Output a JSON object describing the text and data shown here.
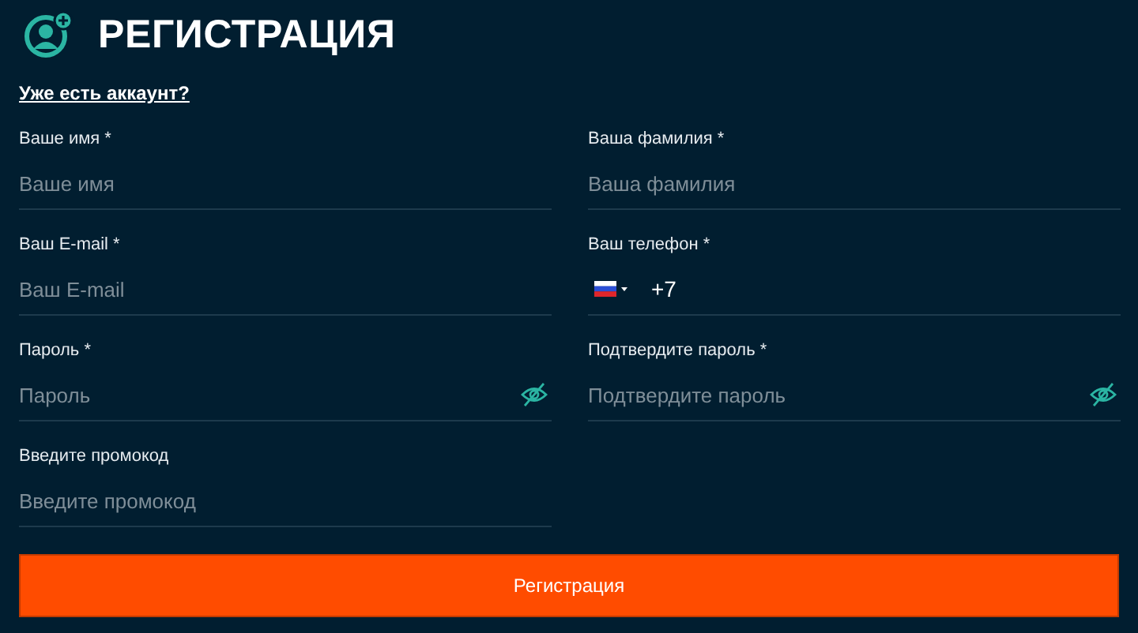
{
  "title": "РЕГИСТРАЦИЯ",
  "login_link": "Уже есть аккаунт?",
  "fields": [
    {
      "kind": "text",
      "label": "Ваше имя *",
      "placeholder": "Ваше имя"
    },
    {
      "kind": "text",
      "label": "Ваша фамилия *",
      "placeholder": "Ваша фамилия"
    },
    {
      "kind": "text",
      "label": "Ваш E-mail *",
      "placeholder": "Ваш E-mail"
    },
    {
      "kind": "phone",
      "label": "Ваш телефон *",
      "value": "+7"
    },
    {
      "kind": "password",
      "label": "Пароль *",
      "placeholder": "Пароль"
    },
    {
      "kind": "password",
      "label": "Подтвердите пароль *",
      "placeholder": "Подтвердите пароль"
    },
    {
      "kind": "text",
      "label": "Введите промокод",
      "placeholder": "Введите промокод"
    }
  ],
  "submit": "Регистрация"
}
